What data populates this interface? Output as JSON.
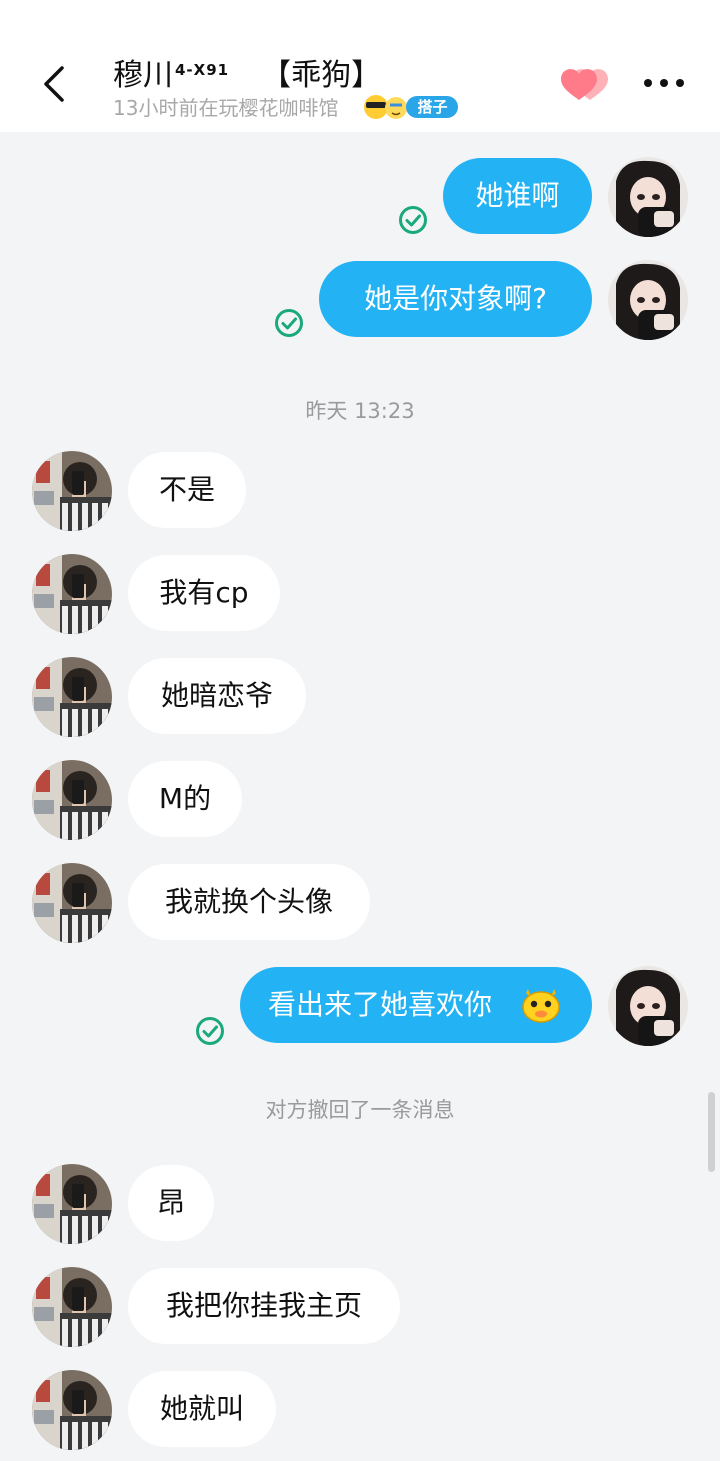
{
  "header": {
    "name": "穆川",
    "name_sup": "4-X91",
    "tag": "【乖狗】",
    "status": "13小时前在玩樱花咖啡馆",
    "badge": "搭子"
  },
  "messages": {
    "out1": "她谁啊",
    "out2": "她是你对象啊?",
    "time1": "昨天 13:23",
    "in1": "不是",
    "in2": "我有cp",
    "in3": "她暗恋爷",
    "in4": "M的",
    "in5": "我就换个头像",
    "out3": "看出来了她喜欢你",
    "recall": "对方撤回了一条消息",
    "in6": "昂",
    "in7": "我把你挂我主页",
    "in8": "她就叫"
  },
  "colors": {
    "outgoing_bubble": "#23b2f3",
    "incoming_bubble": "#ffffff",
    "read_check": "#1aa97a",
    "badge": "#2aa5e8",
    "hearts": "#ff7b8a"
  },
  "icons": {
    "back": "chevron-left-icon",
    "hearts": "hearts-icon",
    "more": "more-dots-icon",
    "read": "read-check-icon",
    "emoji": "yellow-face-emoji"
  }
}
